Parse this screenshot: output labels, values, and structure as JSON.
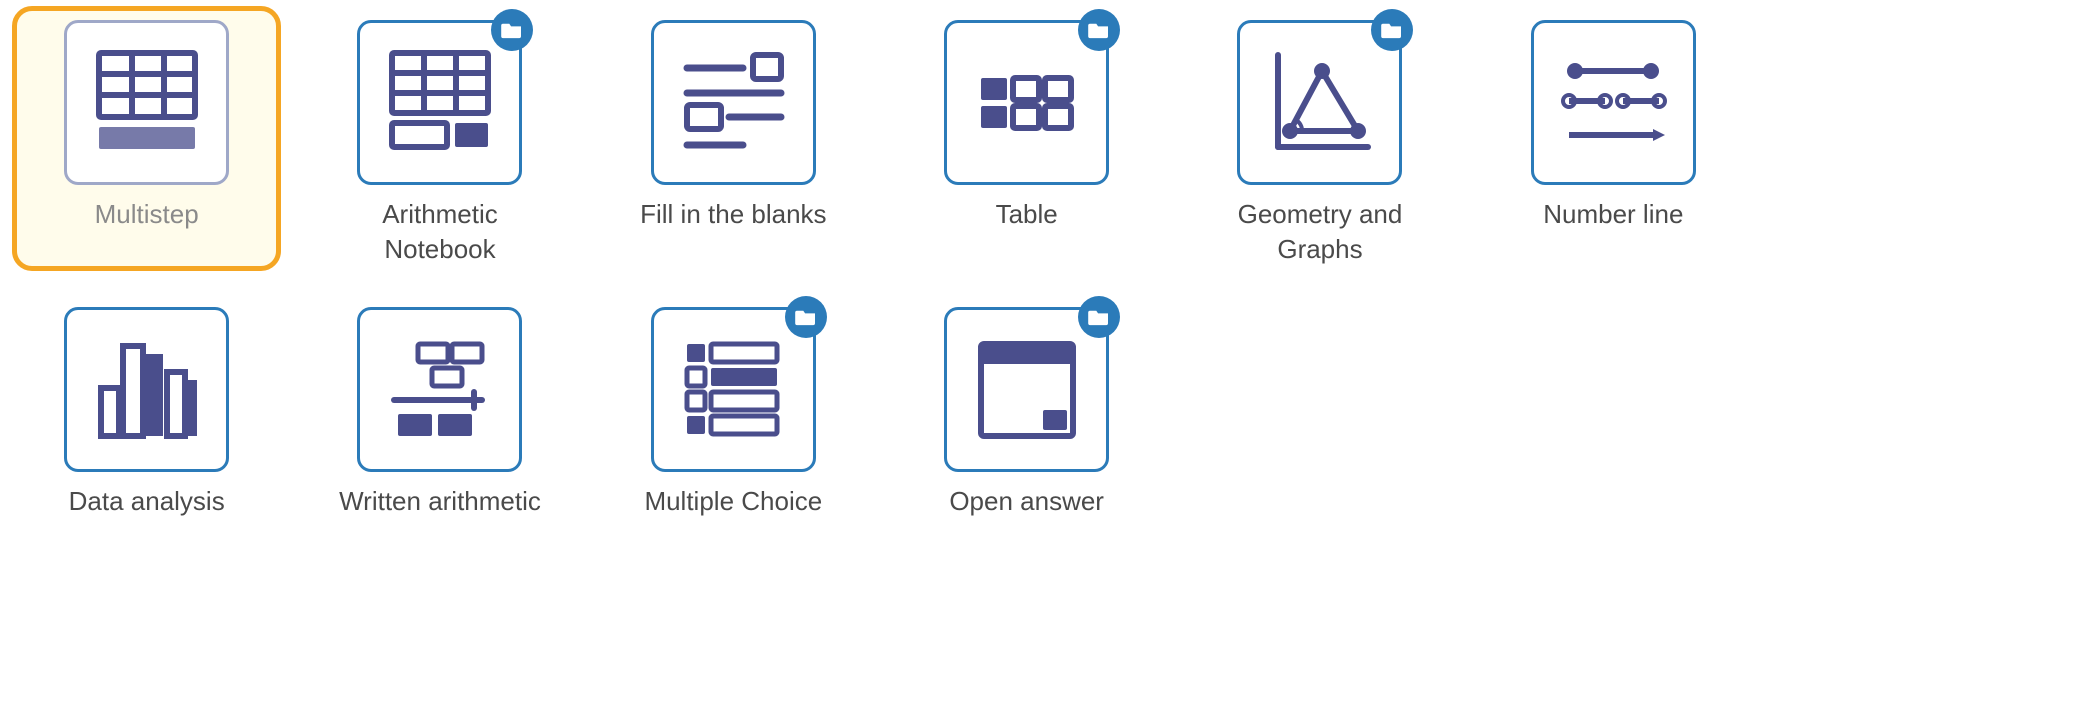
{
  "colors": {
    "border_blue": "#2B7BB9",
    "icon_purple": "#4A4E8C",
    "selected_orange": "#F5A623",
    "selected_bg": "#FFFCEB",
    "text_gray": "#4A4A4A"
  },
  "tiles": [
    {
      "id": "multistep",
      "label": "Multistep",
      "selected": true,
      "has_folder": false
    },
    {
      "id": "arithmetic-notebook",
      "label": "Arithmetic Notebook",
      "selected": false,
      "has_folder": true
    },
    {
      "id": "fill-blanks",
      "label": "Fill in the blanks",
      "selected": false,
      "has_folder": false
    },
    {
      "id": "table",
      "label": "Table",
      "selected": false,
      "has_folder": true
    },
    {
      "id": "geometry-graphs",
      "label": "Geometry and Graphs",
      "selected": false,
      "has_folder": true
    },
    {
      "id": "number-line",
      "label": "Number line",
      "selected": false,
      "has_folder": false
    },
    {
      "id": "data-analysis",
      "label": "Data analysis",
      "selected": false,
      "has_folder": false
    },
    {
      "id": "written-arithmetic",
      "label": "Written arithmetic",
      "selected": false,
      "has_folder": false
    },
    {
      "id": "multiple-choice",
      "label": "Multiple Choice",
      "selected": false,
      "has_folder": true
    },
    {
      "id": "open-answer",
      "label": "Open answer",
      "selected": false,
      "has_folder": true
    }
  ]
}
